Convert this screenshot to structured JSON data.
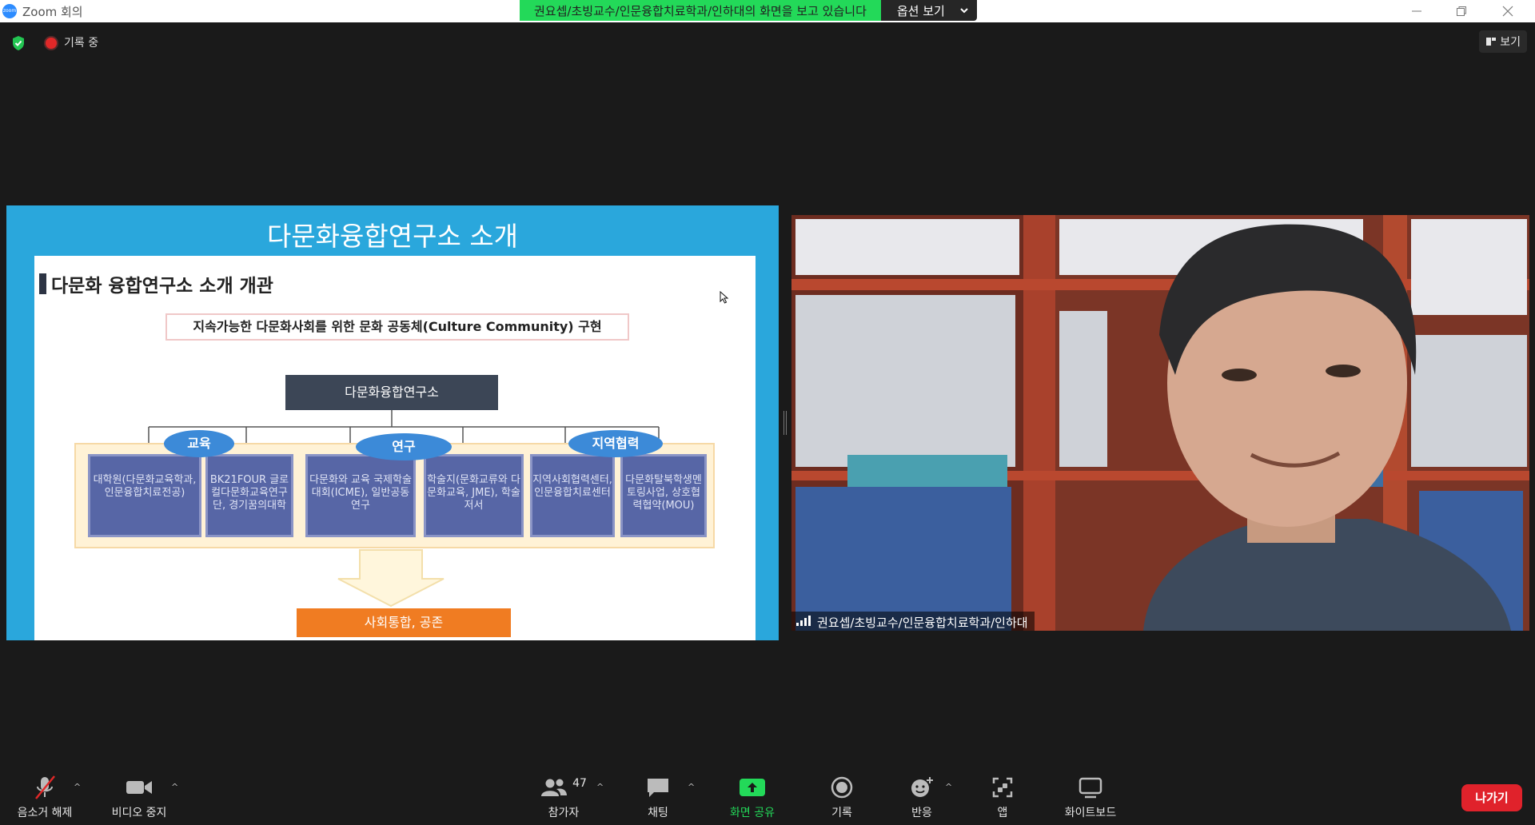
{
  "window": {
    "title": "Zoom 회의",
    "logo_text": "zoom"
  },
  "share_banner": {
    "message": "권요셉/초빙교수/인문융합치료학과/인하대의 화면을 보고 있습니다",
    "options_label": "옵션 보기"
  },
  "status": {
    "recording_label": "기록 중"
  },
  "view_button": {
    "label": "보기"
  },
  "slide": {
    "title": "다문화융합연구소 소개",
    "heading": "다문화 융합연구소 소개 개관",
    "goal": "지속가능한 다문화사회를 위한 문화 공동체(Culture Community) 구현",
    "root": "다문화융합연구소",
    "categories": [
      "교육",
      "연구",
      "지역협력"
    ],
    "boxes": [
      "대학원(다문화교육학과, 인문융합치료전공)",
      "BK21FOUR 글로컬다문화교육연구단, 경기꿈의대학",
      "다문화와 교육 국제학술대회(ICME), 일반공동연구",
      "학술지(문화교류와 다문화교육, JME), 학술저서",
      "지역사회협력센터, 인문융합치료센터",
      "다문화탈북학생멘토링사업, 상호협력협약(MOU)"
    ],
    "result": "사회통합, 공존"
  },
  "camera": {
    "participant_name": "권요셉/초빙교수/인문융합치료학과/인하대"
  },
  "toolbar": {
    "mute": "음소거 해제",
    "video": "비디오 중지",
    "participants": "참가자",
    "participant_count": "47",
    "chat": "채팅",
    "share": "화면 공유",
    "record": "기록",
    "reactions": "반응",
    "apps": "앱",
    "whiteboard": "화이트보드",
    "leave": "나가기"
  },
  "colors": {
    "zoom_blue": "#2d8cff",
    "banner_green": "#23d959",
    "share_green": "#23d959",
    "leave_red": "#e0222b",
    "recording_red": "#e02828"
  }
}
